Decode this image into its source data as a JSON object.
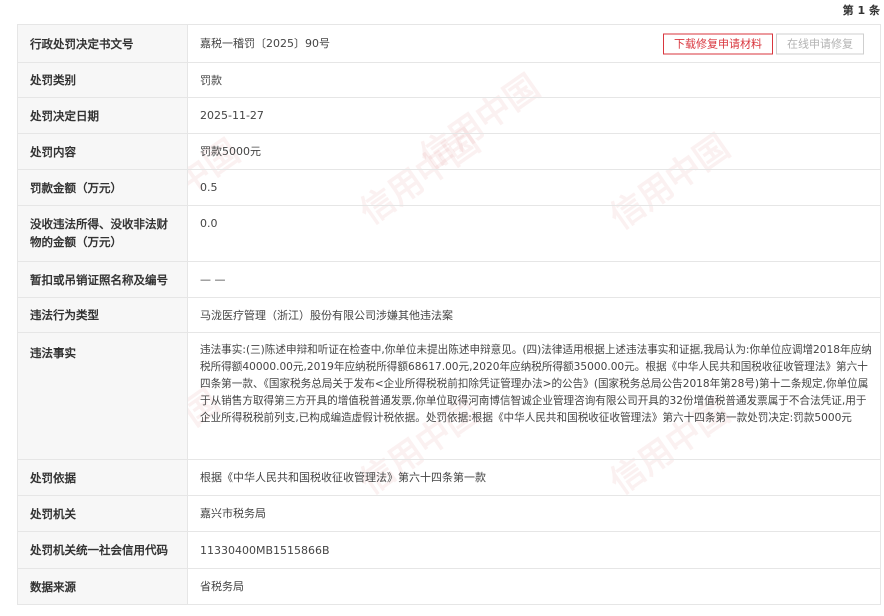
{
  "pagination": {
    "counter": "第 1 条"
  },
  "buttons": {
    "download_repair": "下载修复申请材料",
    "online_repair": "在线申请修复"
  },
  "watermark": "信用中国",
  "records": [
    {
      "label": "行政处罚决定书文号",
      "value": "嘉税一稽罚〔2025〕90号"
    },
    {
      "label": "处罚类别",
      "value": "罚款"
    },
    {
      "label": "处罚决定日期",
      "value": "2025-11-27"
    },
    {
      "label": "处罚内容",
      "value": "罚款5000元"
    },
    {
      "label": "罚款金额（万元）",
      "value": "0.5"
    },
    {
      "label": "没收违法所得、没收非法财物的金额（万元）",
      "value": "0.0"
    },
    {
      "label": "暂扣或吊销证照名称及编号",
      "value": "— —"
    },
    {
      "label": "违法行为类型",
      "value": "马泷医疗管理（浙江）股份有限公司涉嫌其他违法案"
    },
    {
      "label": "违法事实",
      "value": "违法事实:(三)陈述申辩和听证在检查中,你单位未提出陈述申辩意见。(四)法律适用根据上述违法事实和证据,我局认为:你单位应调增2018年应纳税所得额40000.00元,2019年应纳税所得额68617.00元,2020年应纳税所得额35000.00元。根据《中华人民共和国税收征收管理法》第六十四条第一款、《国家税务总局关于发布<企业所得税税前扣除凭证管理办法>的公告》(国家税务总局公告2018年第28号)第十二条规定,你单位属于从销售方取得第三方开具的增值税普通发票,你单位取得河南博信智诚企业管理咨询有限公司开具的32份增值税普通发票属于不合法凭证,用于企业所得税税前列支,已构成编造虚假计税依据。处罚依据:根据《中华人民共和国税收征收管理法》第六十四条第一款处罚决定:罚款5000元"
    },
    {
      "label": "处罚依据",
      "value": "根据《中华人民共和国税收征收管理法》第六十四条第一款"
    },
    {
      "label": "处罚机关",
      "value": "嘉兴市税务局"
    },
    {
      "label": "处罚机关统一社会信用代码",
      "value": "11330400MB1515866B"
    },
    {
      "label": "数据来源",
      "value": "省税务局"
    }
  ]
}
